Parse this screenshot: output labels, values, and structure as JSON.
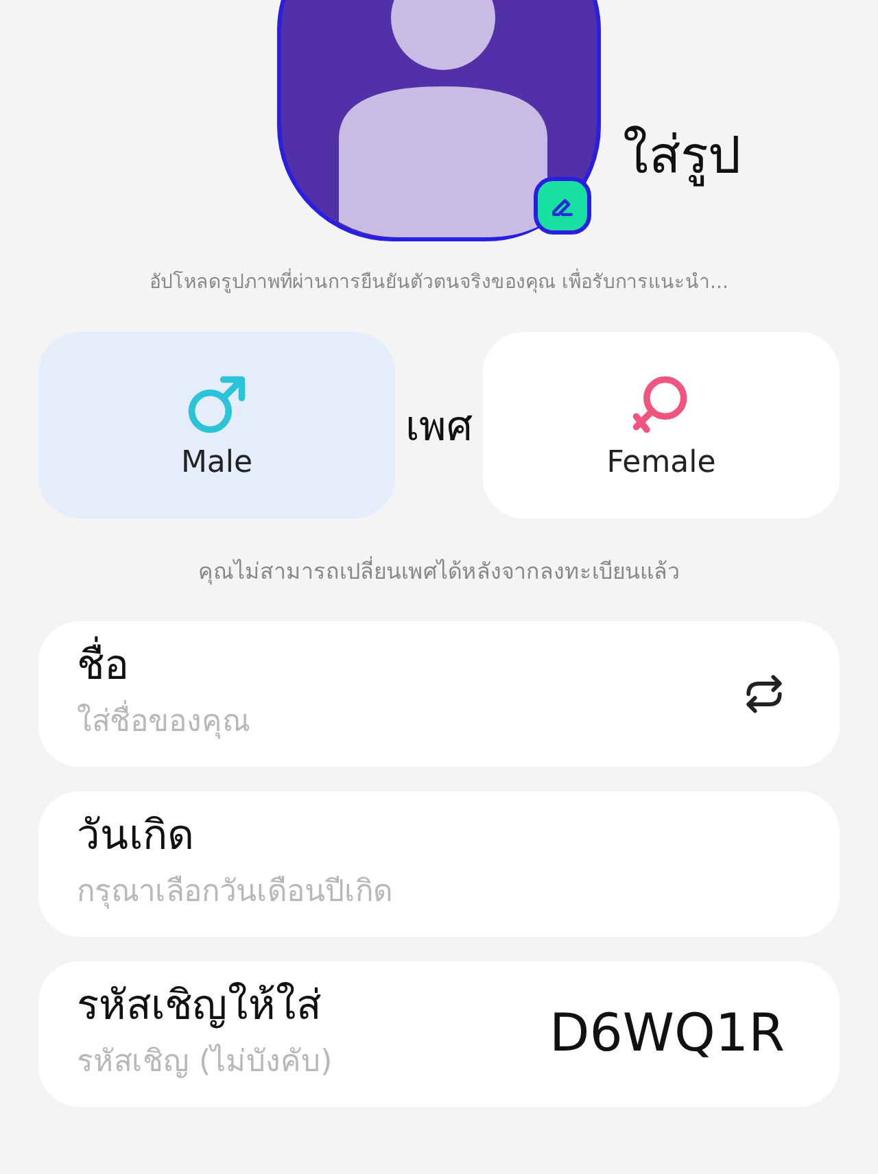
{
  "avatar": {
    "annotation": "ใส่รูป"
  },
  "upload_hint": "อัปโหลดรูปภาพที่ผ่านการยืนยันตัวตนจริงของคุณ เพื่อรับการแนะนำ...",
  "gender": {
    "annotation": "เพศ",
    "options": [
      {
        "label": "Male",
        "kind": "male",
        "selected": true
      },
      {
        "label": "Female",
        "kind": "female",
        "selected": false
      }
    ]
  },
  "gender_note": "คุณไม่สามารถเปลี่ยนเพศได้หลังจากลงทะเบียนแล้ว",
  "fields": [
    {
      "placeholder": "ใส่ชื่อของคุณ",
      "annotation": "ชื่อ",
      "kind": "refresh"
    },
    {
      "placeholder": "กรุณาเลือกวันเดือนปีเกิด",
      "annotation": "วันเกิด",
      "kind": "plain"
    },
    {
      "placeholder": "รหัสเชิญ (ไม่บังคับ)",
      "annotation": "รหัสเชิญให้ใส่",
      "value_annotation": "D6WQ1R",
      "kind": "plain"
    }
  ]
}
